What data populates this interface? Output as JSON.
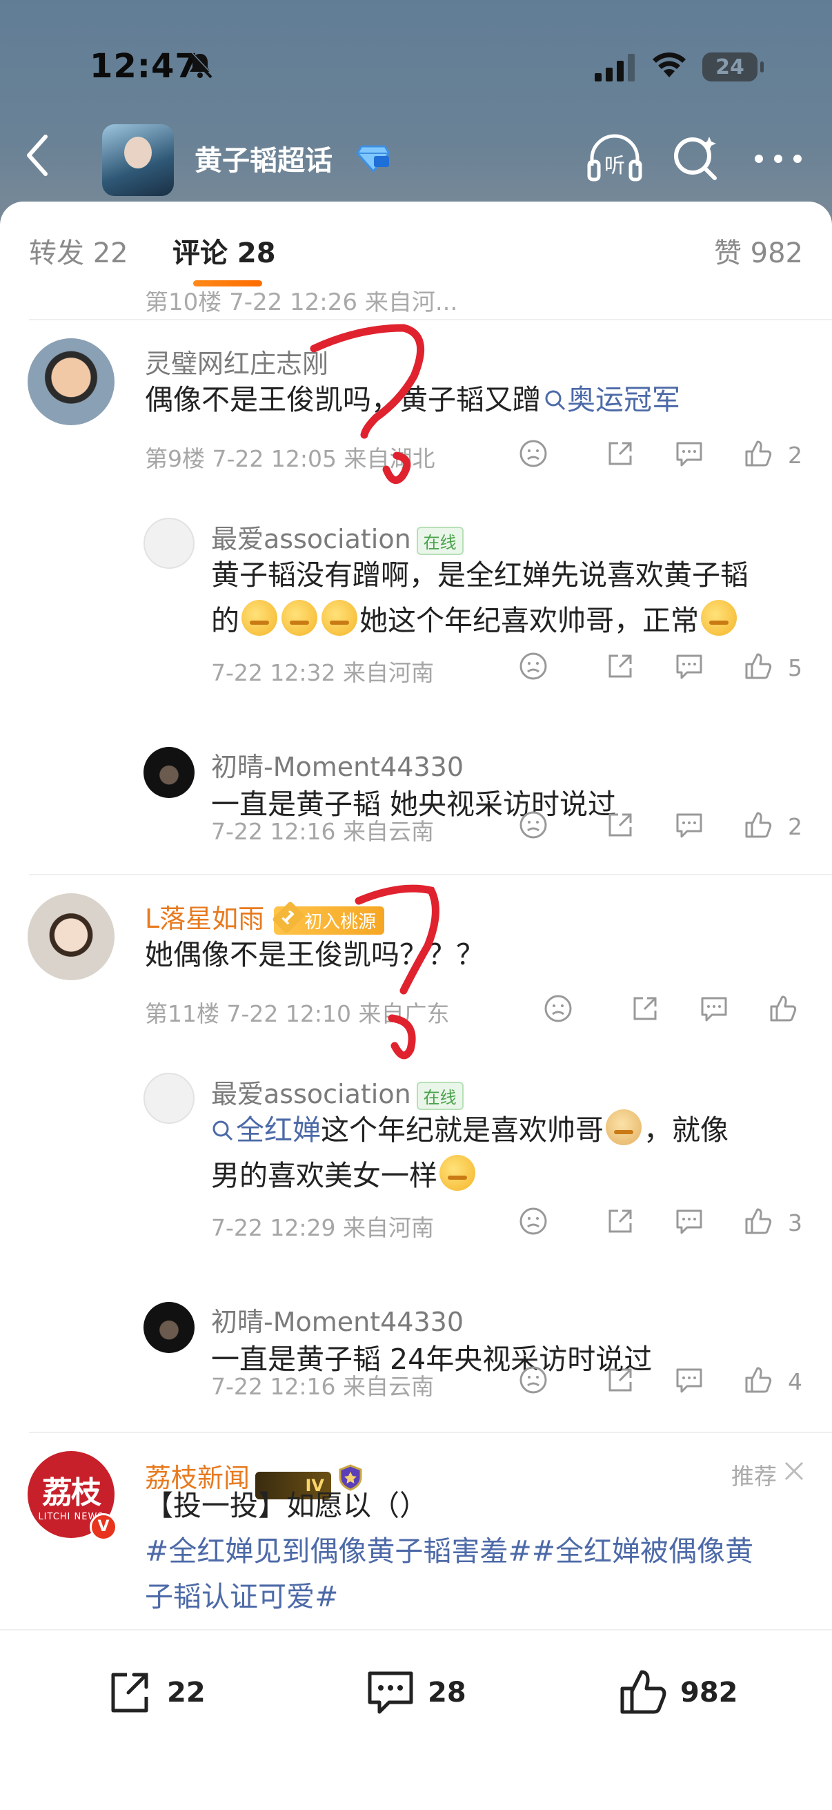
{
  "status_bar": {
    "time": "12:47",
    "battery": "24"
  },
  "nav": {
    "title": "黄子韬超话"
  },
  "tabs": {
    "repost": "转发 22",
    "comments": "评论 28",
    "likes": "赞 982"
  },
  "peek_row": {
    "text": "第10楼 7-22 12:26 来自河..."
  },
  "comments": [
    {
      "name": "灵璧网红庄志刚",
      "text_plain": "偶像不是王俊凯吗，黄子韬又蹭",
      "link": "奥运冠军",
      "meta": "第9楼 7-22 12:05 来自湖北",
      "likes": "2",
      "replies": [
        {
          "name": "最爱association",
          "badge": "在线",
          "text1": "黄子韬没有蹭啊，是全红婵先说喜欢黄子韬",
          "text2_pre": "的",
          "text2_post": "她这个年纪喜欢帅哥，正常",
          "meta": "7-22 12:32 来自河南",
          "likes": "5"
        },
        {
          "name": "初晴-Moment44330",
          "text": "一直是黄子韬 她央视采访时说过",
          "meta": "7-22 12:16 来自云南",
          "likes": "2"
        }
      ]
    },
    {
      "name": "L落星如雨",
      "badge": "初入桃源",
      "text": "她偶像不是王俊凯吗？？？",
      "meta": "第11楼 7-22 12:10 来自广东",
      "likes": "",
      "replies": [
        {
          "name": "最爱association",
          "badge": "在线",
          "link": "全红婵",
          "text1_post": "这个年纪就是喜欢帅哥",
          "text1_tail": "，就像",
          "text2": "男的喜欢美女一样",
          "meta": "7-22 12:29 来自河南",
          "likes": "3"
        },
        {
          "name": "初晴-Moment44330",
          "text": "一直是黄子韬 24年央视采访时说过",
          "meta": "7-22 12:16 来自云南",
          "likes": "4"
        }
      ]
    }
  ],
  "ad": {
    "name": "荔枝新闻",
    "logo_text": "荔枝",
    "logo_sub": "LITCHI NEWS",
    "level": "IV",
    "tag": "推荐",
    "line1": "【投一投】如愿以（）",
    "hashtags_line1": "#全红婵见到偶像黄子韬害羞##全红婵被偶像黄",
    "hashtags_line2": "子韬认证可爱#"
  },
  "bottom_bar": {
    "reposts": "22",
    "comments": "28",
    "likes": "982"
  },
  "colors": {
    "accent": "#ff7a00",
    "link": "#4d6aa8",
    "annotation": "#e0222e"
  }
}
